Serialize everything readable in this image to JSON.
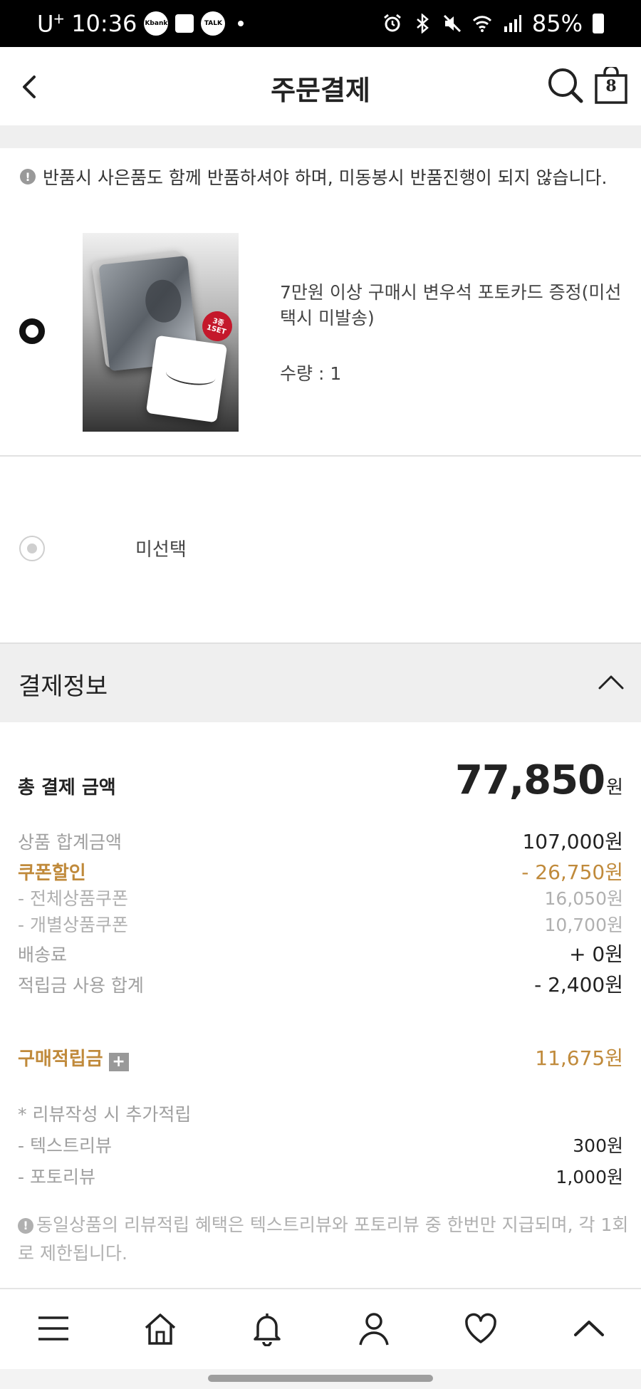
{
  "status_bar": {
    "carrier": "U",
    "carrier_sup": "+",
    "time": "10:36",
    "app_badges": [
      "Kbank",
      "TALK"
    ],
    "battery": "85%"
  },
  "header": {
    "title": "주문결제",
    "cart_count": "8"
  },
  "notice": {
    "text": "반품시 사은품도 함께 반품하셔야 하며, 미동봉시 반품진행이 되지 않습니다."
  },
  "gift_options": [
    {
      "name": "7만원 이상 구매시 변우석 포토카드 증정(미선택시 미발송)",
      "quantity": "수량 : 1",
      "badge": "3종 1SET",
      "selected": true
    },
    {
      "name": "미선택",
      "selected": false
    }
  ],
  "payment": {
    "section_title": "결제정보",
    "total_label": "총 결제 금액",
    "total_amount": "77,850",
    "total_unit": "원",
    "product_total_label": "상품 합계금액",
    "product_total_value": "107,000원",
    "coupon_label": "쿠폰할인",
    "coupon_value": "- 26,750원",
    "all_coupon_label": "- 전체상품쿠폰",
    "all_coupon_value": "16,050원",
    "item_coupon_label": "- 개별상품쿠폰",
    "item_coupon_value": "10,700원",
    "shipping_label": "배송료",
    "shipping_value": "+ 0원",
    "points_used_label": "적립금 사용 합계",
    "points_used_value": "- 2,400원",
    "earn_label": "구매적립금",
    "earn_value": "11,675원",
    "review_title": "* 리뷰작성 시 추가적립",
    "text_review_label": "- 텍스트리뷰",
    "text_review_value": "300원",
    "photo_review_label": "- 포토리뷰",
    "photo_review_value": "1,000원",
    "review_note": "동일상품의 리뷰적립 혜택은 텍스트리뷰와 포토리뷰 중 한번만 지급되며, 각 1회로 제한됩니다."
  },
  "colors": {
    "accent_gold": "#c08a3b",
    "text_dark": "#222222",
    "text_gray": "#a0a0a0",
    "section_bg": "#efefef",
    "badge_red": "#c4182b"
  },
  "bottom_nav": [
    "menu-icon",
    "home-icon",
    "bell-icon",
    "user-icon",
    "heart-icon",
    "chevron-up-icon"
  ]
}
